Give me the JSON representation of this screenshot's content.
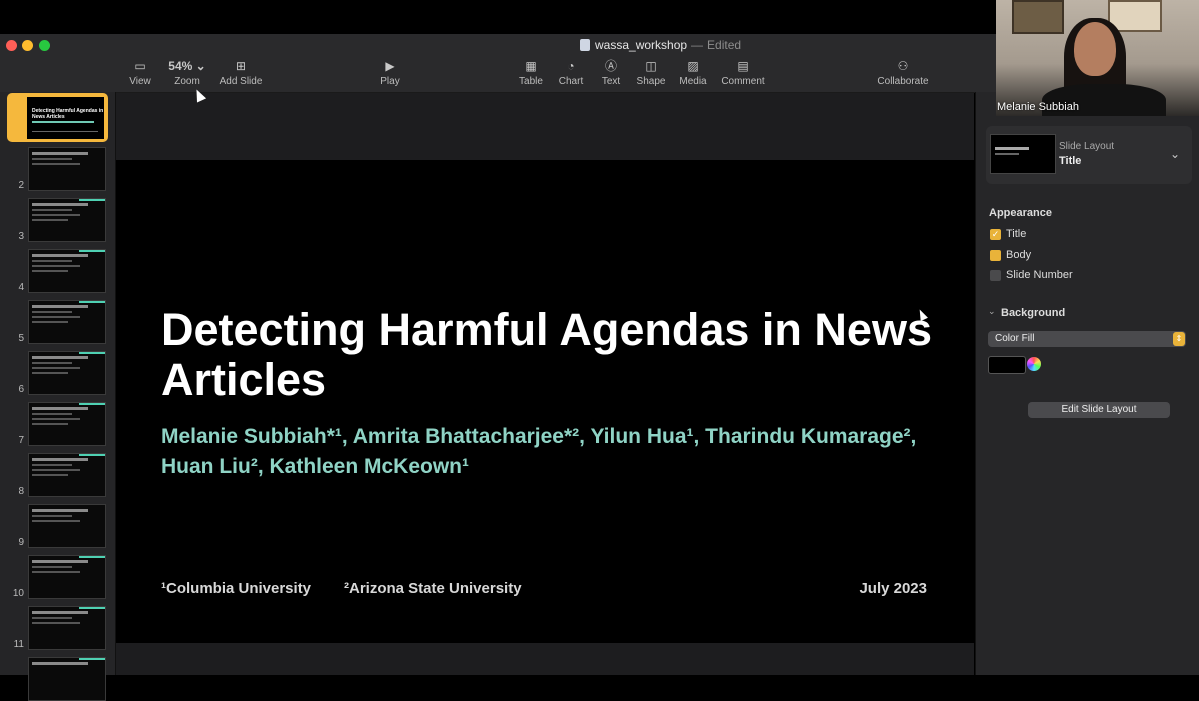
{
  "window": {
    "filename": "wassa_workshop",
    "separator": "—",
    "status": "Edited"
  },
  "toolbar": {
    "view": "View",
    "zoom_value": "54%",
    "zoom": "Zoom",
    "add_slide": "Add Slide",
    "play": "Play",
    "table": "Table",
    "chart": "Chart",
    "text": "Text",
    "shape": "Shape",
    "media": "Media",
    "comment": "Comment",
    "collaborate": "Collaborate"
  },
  "navigator": {
    "thumb1_title": "Detecting Harmful Agendas in News Articles",
    "slide_numbers": [
      "2",
      "3",
      "4",
      "5",
      "6",
      "7",
      "8",
      "9",
      "10",
      "11"
    ]
  },
  "slide": {
    "title": "Detecting Harmful Agendas in News Articles",
    "authors": "Melanie Subbiah*¹, Amrita Bhattacharjee*², Yilun Hua¹, Tharindu Kumarage², Huan Liu², Kathleen McKeown¹",
    "affiliation1": "¹Columbia University",
    "affiliation2": "²Arizona State University",
    "date": "July 2023"
  },
  "inspector": {
    "layout_label": "Slide Layout",
    "layout_value": "Title",
    "appearance_heading": "Appearance",
    "opt_title": "Title",
    "opt_body": "Body",
    "opt_slide_number": "Slide Number",
    "background_heading": "Background",
    "fill_value": "Color Fill",
    "edit_layout": "Edit Slide Layout"
  },
  "webcam": {
    "name": "Melanie Subbiah"
  }
}
